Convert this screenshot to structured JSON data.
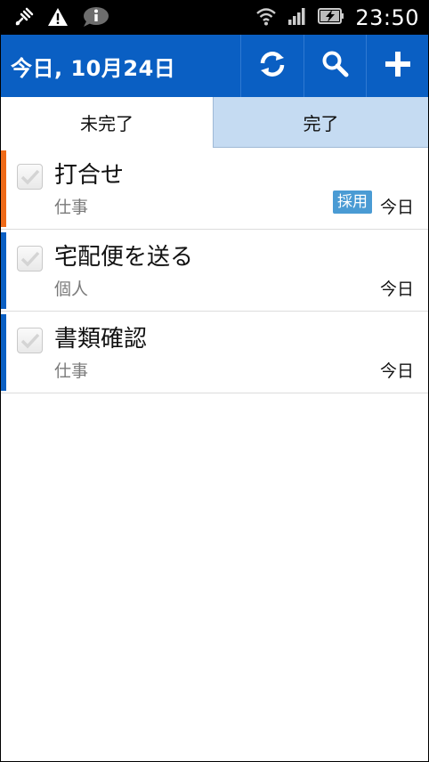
{
  "status_bar": {
    "time": "23:50",
    "icons_left": [
      "usb-debug-icon",
      "warning-icon",
      "info-icon"
    ],
    "icons_right": [
      "wifi-icon",
      "signal-icon",
      "battery-charging-icon"
    ]
  },
  "action_bar": {
    "title": "今日, 10月24日",
    "color": "#0a5fc3"
  },
  "tabs": [
    {
      "label": "未完了",
      "active": true
    },
    {
      "label": "完了",
      "active": false
    }
  ],
  "tasks": [
    {
      "title": "打合せ",
      "category": "仕事",
      "badge": "採用",
      "due": "今日",
      "color": "#ef6a17"
    },
    {
      "title": "宅配便を送る",
      "category": "個人",
      "badge": "",
      "due": "今日",
      "color": "#0a5fc3"
    },
    {
      "title": "書類確認",
      "category": "仕事",
      "badge": "",
      "due": "今日",
      "color": "#0a5fc3"
    }
  ]
}
